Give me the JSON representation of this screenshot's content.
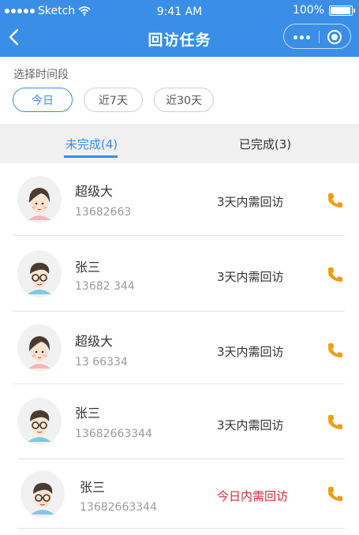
{
  "status_bar": {
    "carrier": "Sketch",
    "time": "9:41 AM",
    "battery": "100%",
    "battery_level": 1.0
  },
  "nav": {
    "title": "回访任务"
  },
  "filter": {
    "label": "选择时间段",
    "options": [
      {
        "label": "今日",
        "active": true
      },
      {
        "label": "近7天",
        "active": false
      },
      {
        "label": "近30天",
        "active": false
      }
    ]
  },
  "tabs": [
    {
      "label": "未完成(4)",
      "active": true
    },
    {
      "label": "已完成(3)",
      "active": false
    }
  ],
  "tasks": [
    {
      "name": "超级大",
      "phone": "13682663",
      "status": "3天内需回访",
      "urgent": false,
      "avatar": "female-avatar"
    },
    {
      "name": "张三",
      "phone": "13682 344",
      "status": "3天内需回访",
      "urgent": false,
      "avatar": "male-glasses-avatar"
    },
    {
      "name": "超级大",
      "phone": "13 66334",
      "status": "3天内需回访",
      "urgent": false,
      "avatar": "female-avatar"
    },
    {
      "name": "张三",
      "phone": "13682663344",
      "status": "3天内需回访",
      "urgent": false,
      "avatar": "male-glasses-avatar"
    },
    {
      "name": "张三",
      "phone": "13682663344",
      "status": "今日内需回访",
      "urgent": true,
      "avatar": "male-glasses-avatar"
    }
  ],
  "colors": {
    "primary": "#3a8ee6",
    "urgent": "#d8273d",
    "call": "#f39c12"
  },
  "icons": {
    "back": "back-chevron-icon",
    "more": "more-dots-icon",
    "close": "target-circle-icon",
    "call": "phone-icon"
  }
}
